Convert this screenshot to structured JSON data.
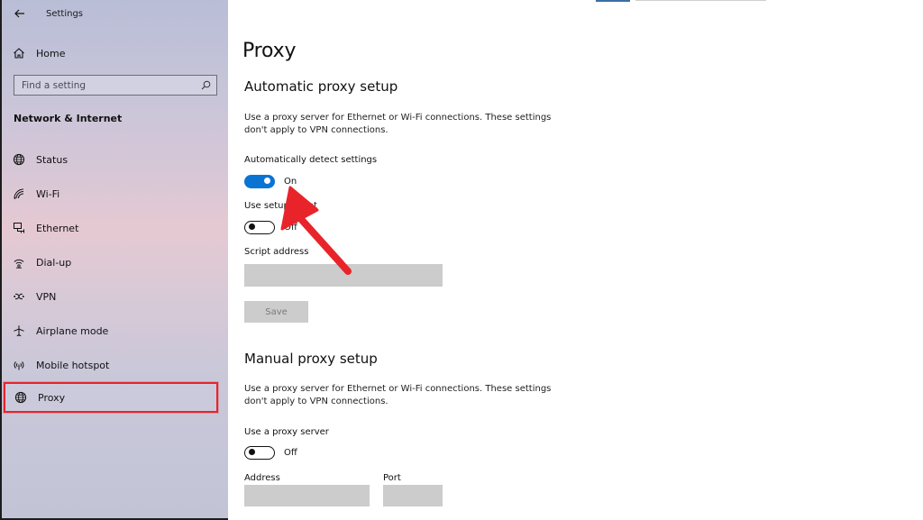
{
  "window": {
    "title": "Settings"
  },
  "sidebar": {
    "home_label": "Home",
    "search_placeholder": "Find a setting",
    "section_title": "Network & Internet",
    "items": [
      {
        "label": "Status",
        "icon": "globe-icon"
      },
      {
        "label": "Wi-Fi",
        "icon": "wifi-icon"
      },
      {
        "label": "Ethernet",
        "icon": "ethernet-icon"
      },
      {
        "label": "Dial-up",
        "icon": "dialup-icon"
      },
      {
        "label": "VPN",
        "icon": "vpn-icon"
      },
      {
        "label": "Airplane mode",
        "icon": "airplane-icon"
      },
      {
        "label": "Mobile hotspot",
        "icon": "hotspot-icon"
      },
      {
        "label": "Proxy",
        "icon": "globe-icon",
        "selected": true
      }
    ]
  },
  "main": {
    "title": "Proxy",
    "automatic": {
      "heading": "Automatic proxy setup",
      "description": "Use a proxy server for Ethernet or Wi-Fi connections. These settings don't apply to VPN connections.",
      "auto_detect_label": "Automatically detect settings",
      "auto_detect_state": "On",
      "setup_script_label": "Use setup script",
      "setup_script_state": "Off",
      "script_address_label": "Script address",
      "script_address_value": "",
      "save_label": "Save"
    },
    "manual": {
      "heading": "Manual proxy setup",
      "description": "Use a proxy server for Ethernet or Wi-Fi connections. These settings don't apply to VPN connections.",
      "use_proxy_label": "Use a proxy server",
      "use_proxy_state": "Off",
      "address_label": "Address",
      "address_value": "",
      "port_label": "Port",
      "port_value": ""
    }
  },
  "colors": {
    "accent": "#0a74d5",
    "highlight_box": "#e8242a",
    "annotation_arrow": "#e8242a"
  }
}
